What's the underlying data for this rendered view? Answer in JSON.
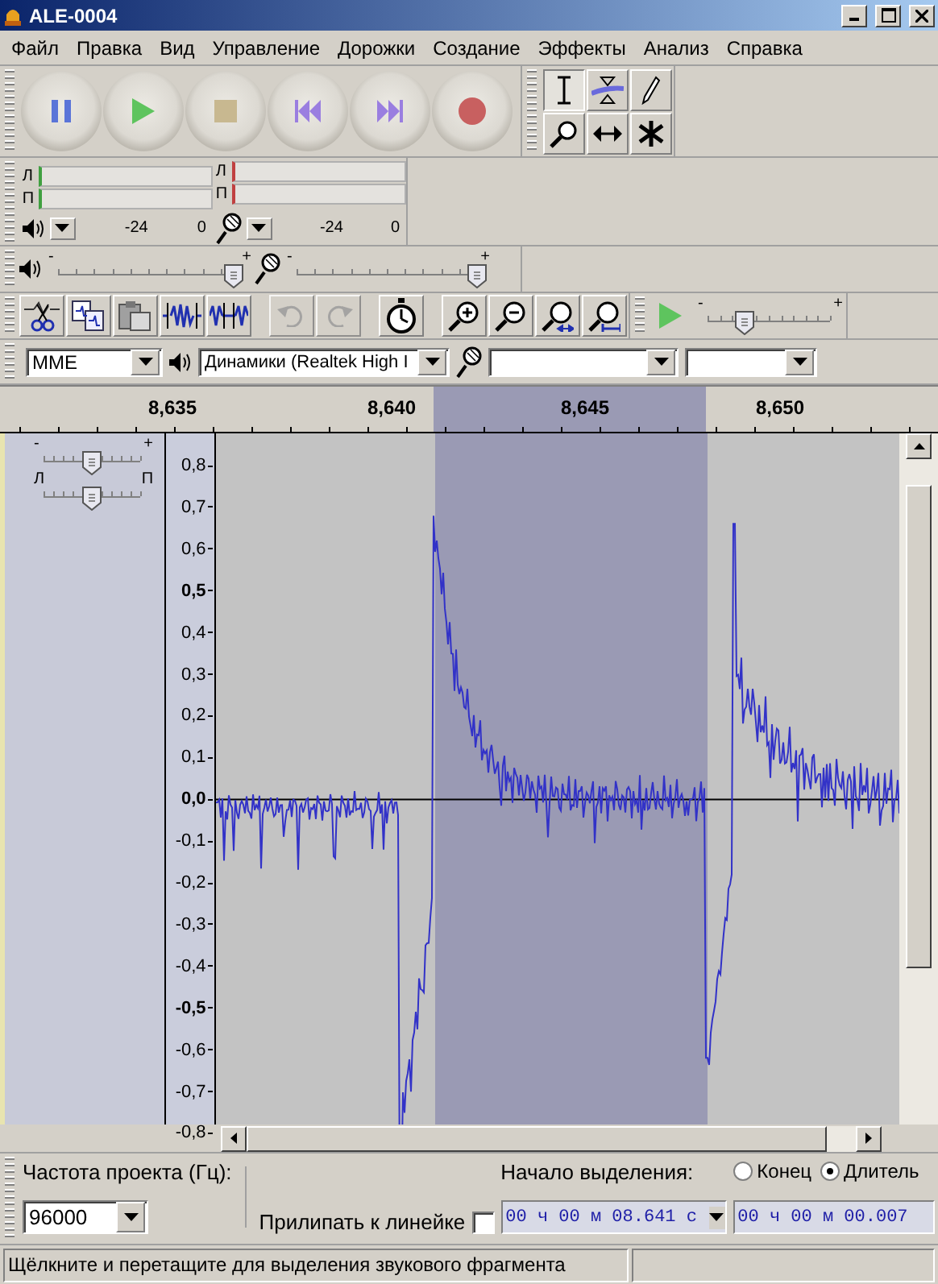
{
  "window": {
    "title": "ALE-0004"
  },
  "menu": [
    "Файл",
    "Правка",
    "Вид",
    "Управление",
    "Дорожки",
    "Создание",
    "Эффекты",
    "Анализ",
    "Справка"
  ],
  "transport": [
    {
      "kind": "pause"
    },
    {
      "kind": "play"
    },
    {
      "kind": "stop"
    },
    {
      "kind": "skip-start"
    },
    {
      "kind": "skip-end"
    },
    {
      "kind": "record"
    }
  ],
  "tools": [
    {
      "kind": "select",
      "selected": true
    },
    {
      "kind": "envelope",
      "selected": false
    },
    {
      "kind": "draw",
      "selected": false
    },
    {
      "kind": "zoom",
      "selected": false
    },
    {
      "kind": "timeshift",
      "selected": false
    },
    {
      "kind": "multi",
      "selected": false
    }
  ],
  "meters": [
    {
      "kind": "playback",
      "channels": [
        "Л",
        "П"
      ],
      "ticks": [
        "-24",
        "0"
      ]
    },
    {
      "kind": "record",
      "channels": [
        "Л",
        "П"
      ],
      "ticks": [
        "-24",
        "0"
      ]
    }
  ],
  "mixer": [
    {
      "kind": "playback",
      "min_label": "-",
      "max_label": "+",
      "level": 0.97
    },
    {
      "kind": "record",
      "min_label": "-",
      "max_label": "+",
      "level": 1.0
    }
  ],
  "edit_tools": [
    {
      "kind": "trim",
      "disabled": false
    },
    {
      "kind": "silence",
      "disabled": false
    },
    {
      "kind": "paste",
      "disabled": false
    },
    {
      "kind": "trim-audio",
      "disabled": false
    },
    {
      "kind": "silence-audio",
      "disabled": false
    },
    {
      "kind": "undo",
      "disabled": true
    },
    {
      "kind": "redo",
      "disabled": true
    },
    {
      "kind": "sync",
      "disabled": false
    },
    {
      "kind": "zoom-in",
      "disabled": false
    },
    {
      "kind": "zoom-out",
      "disabled": false
    },
    {
      "kind": "fit-selection",
      "disabled": false
    },
    {
      "kind": "fit-project",
      "disabled": false
    }
  ],
  "play_at_speed": {
    "min_label": "-",
    "max_label": "+",
    "level": 0.3
  },
  "devices": {
    "host": "MME",
    "output": "Динамики (Realtek High I"
  },
  "time_ruler": [
    "8,635",
    "8,640",
    "8,645",
    "8,650"
  ],
  "track": {
    "gain": {
      "min_label": "-",
      "max_label": "+",
      "level": 0.5
    },
    "pan": {
      "min_label": "Л",
      "max_label": "П",
      "level": 0.5
    },
    "amplitude_ticks": [
      {
        "label": "0,8",
        "major": false
      },
      {
        "label": "0,7",
        "major": false
      },
      {
        "label": "0,6",
        "major": false
      },
      {
        "label": "0,5",
        "major": true
      },
      {
        "label": "0,4",
        "major": false
      },
      {
        "label": "0,3",
        "major": false
      },
      {
        "label": "0,2",
        "major": false
      },
      {
        "label": "0,1",
        "major": false
      },
      {
        "label": "0,0",
        "major": true
      },
      {
        "label": "-0,1",
        "major": false
      },
      {
        "label": "-0,2",
        "major": false
      },
      {
        "label": "-0,3",
        "major": false
      },
      {
        "label": "-0,4",
        "major": false
      },
      {
        "label": "-0,5",
        "major": true
      },
      {
        "label": "-0,6",
        "major": false
      },
      {
        "label": "-0,7",
        "major": false
      },
      {
        "label": "-0,8",
        "major": false
      }
    ]
  },
  "selection_bar": {
    "rate_label": "Частота проекта (Гц):",
    "rate": "96000",
    "snap_label": "Прилипать к линейке",
    "snap": false,
    "start_label": "Начало выделения:",
    "end_modes": [
      {
        "label": "Конец",
        "selected": false
      },
      {
        "label": "Длитель",
        "selected": true
      }
    ],
    "start_time": "00 ч 00 м 08.641 с",
    "end_time": "00 ч 00 м 00.007"
  },
  "status_bar": {
    "text": "Щёлкните и перетащите для выделения звукового фрагмента"
  }
}
